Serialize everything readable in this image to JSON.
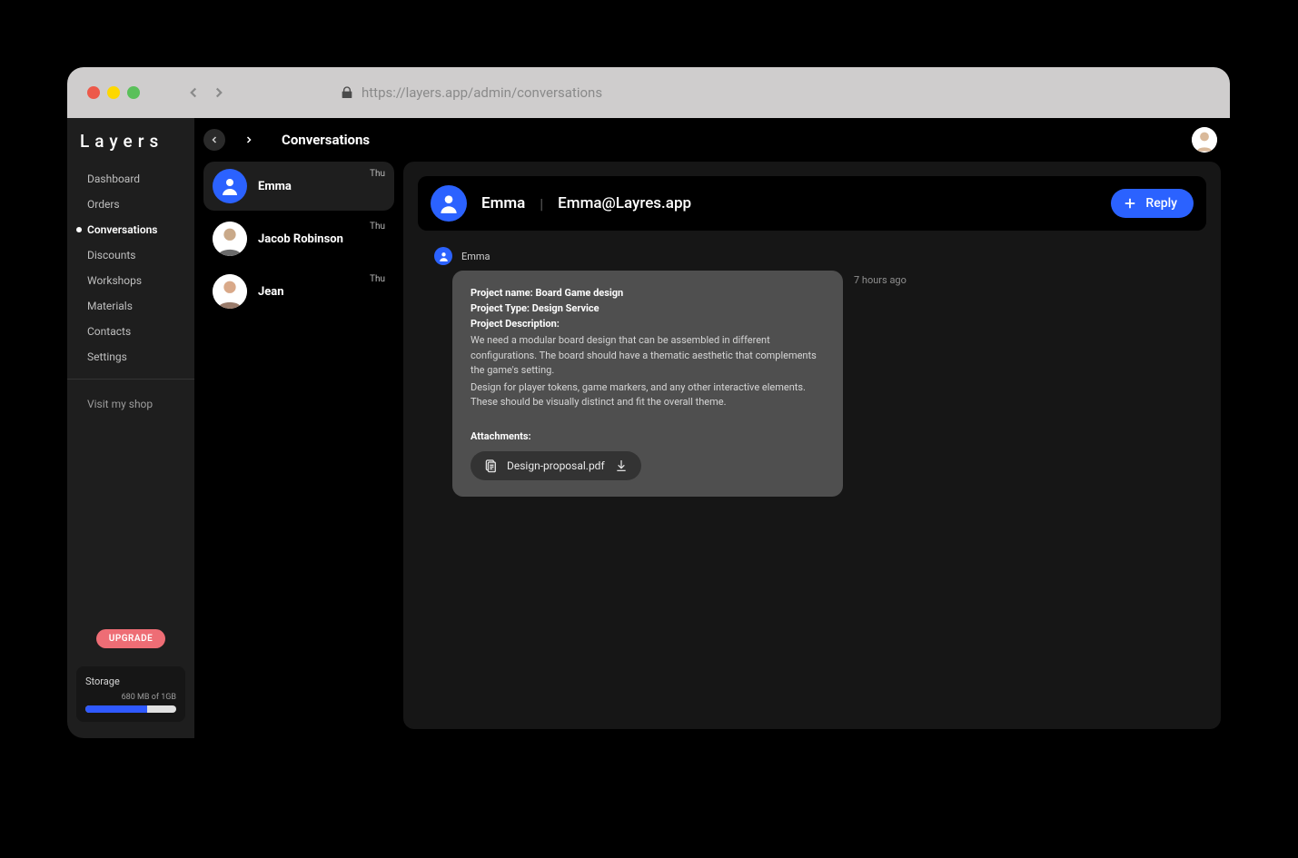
{
  "url": "https://layers.app/admin/conversations",
  "brand": "Layers",
  "sidebar": {
    "items": [
      {
        "label": "Dashboard"
      },
      {
        "label": "Orders"
      },
      {
        "label": "Conversations",
        "active": true
      },
      {
        "label": "Discounts"
      },
      {
        "label": "Workshops"
      },
      {
        "label": "Materials"
      },
      {
        "label": "Contacts"
      },
      {
        "label": "Settings"
      }
    ],
    "visit_shop": "Visit my shop",
    "upgrade": "UPGRADE",
    "storage": {
      "title": "Storage",
      "subtitle": "680 MB of 1GB",
      "percent": 68
    }
  },
  "topbar": {
    "title": "Conversations"
  },
  "conversations": [
    {
      "name": "Emma",
      "time": "Thu",
      "selected": true,
      "avatar": "blue"
    },
    {
      "name": "Jacob Robinson",
      "time": "Thu",
      "selected": false,
      "avatar": "photo"
    },
    {
      "name": "Jean",
      "time": "Thu",
      "selected": false,
      "avatar": "photo"
    }
  ],
  "detail": {
    "name": "Emma",
    "email": "Emma@Layres.app",
    "reply_label": "Reply",
    "message": {
      "sender": "Emma",
      "time": "7 hours ago",
      "fields": {
        "project_name_label": "Project name:",
        "project_name_value": " Board Game design",
        "project_type_label": "Project Type:",
        "project_type_value": " Design Service",
        "project_desc_label": "Project Description:",
        "desc1": "We need a modular board design that can be assembled in different configurations. The board should have a thematic aesthetic that complements the game's setting.",
        "desc2": "Design for player tokens, game markers, and any other interactive elements. These should be visually distinct and fit the overall theme."
      },
      "attachments_label": "Attachments:",
      "attachment_name": "Design-proposal.pdf"
    }
  }
}
